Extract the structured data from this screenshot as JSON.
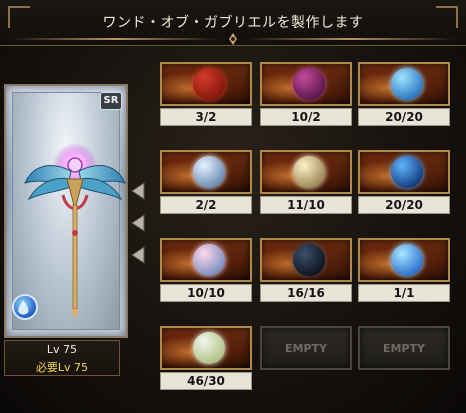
{
  "header": {
    "title": "ワンド・オブ・ガブリエルを製作します"
  },
  "weapon": {
    "rarity": "SR",
    "level": "Lv 75",
    "required_level": "必要Lv 75",
    "element_icon": "water-element-icon",
    "art_icon": "winged-staff-icon"
  },
  "materials": [
    {
      "icon": "red-scroll-icon",
      "count": "3/2",
      "orb": [
        "#d43b2a",
        "#7a1208"
      ]
    },
    {
      "icon": "spirit-wisp-icon",
      "count": "10/2",
      "orb": [
        "#c24a9a",
        "#4d1040"
      ]
    },
    {
      "icon": "water-orb-icon",
      "count": "20/20",
      "orb": [
        "#9fe3ff",
        "#1c68b8"
      ]
    },
    {
      "icon": "silver-fairy-orb-icon",
      "count": "2/2",
      "orb": [
        "#e8f2ff",
        "#5a7ea6"
      ]
    },
    {
      "icon": "golden-angel-orb-icon",
      "count": "11/10",
      "orb": [
        "#fff1c9",
        "#8f7a4a"
      ]
    },
    {
      "icon": "deep-blue-orb-icon",
      "count": "20/20",
      "orb": [
        "#5fb3ff",
        "#0b2d6e"
      ]
    },
    {
      "icon": "pink-fairy-orb-icon",
      "count": "10/10",
      "orb": [
        "#ffd7ef",
        "#6a86b5"
      ]
    },
    {
      "icon": "dark-crystal-icon",
      "count": "16/16",
      "orb": [
        "#3b4f6b",
        "#0a0d14"
      ]
    },
    {
      "icon": "blue-halo-icon",
      "count": "1/1",
      "orb": [
        "#a9e6ff",
        "#1b62c7"
      ]
    },
    {
      "icon": "silver-leaf-icon",
      "count": "46/30",
      "orb": [
        "#f2f7ea",
        "#a6ba7a"
      ]
    }
  ],
  "empty_slots": [
    {
      "label": "EMPTY"
    },
    {
      "label": "EMPTY"
    }
  ]
}
